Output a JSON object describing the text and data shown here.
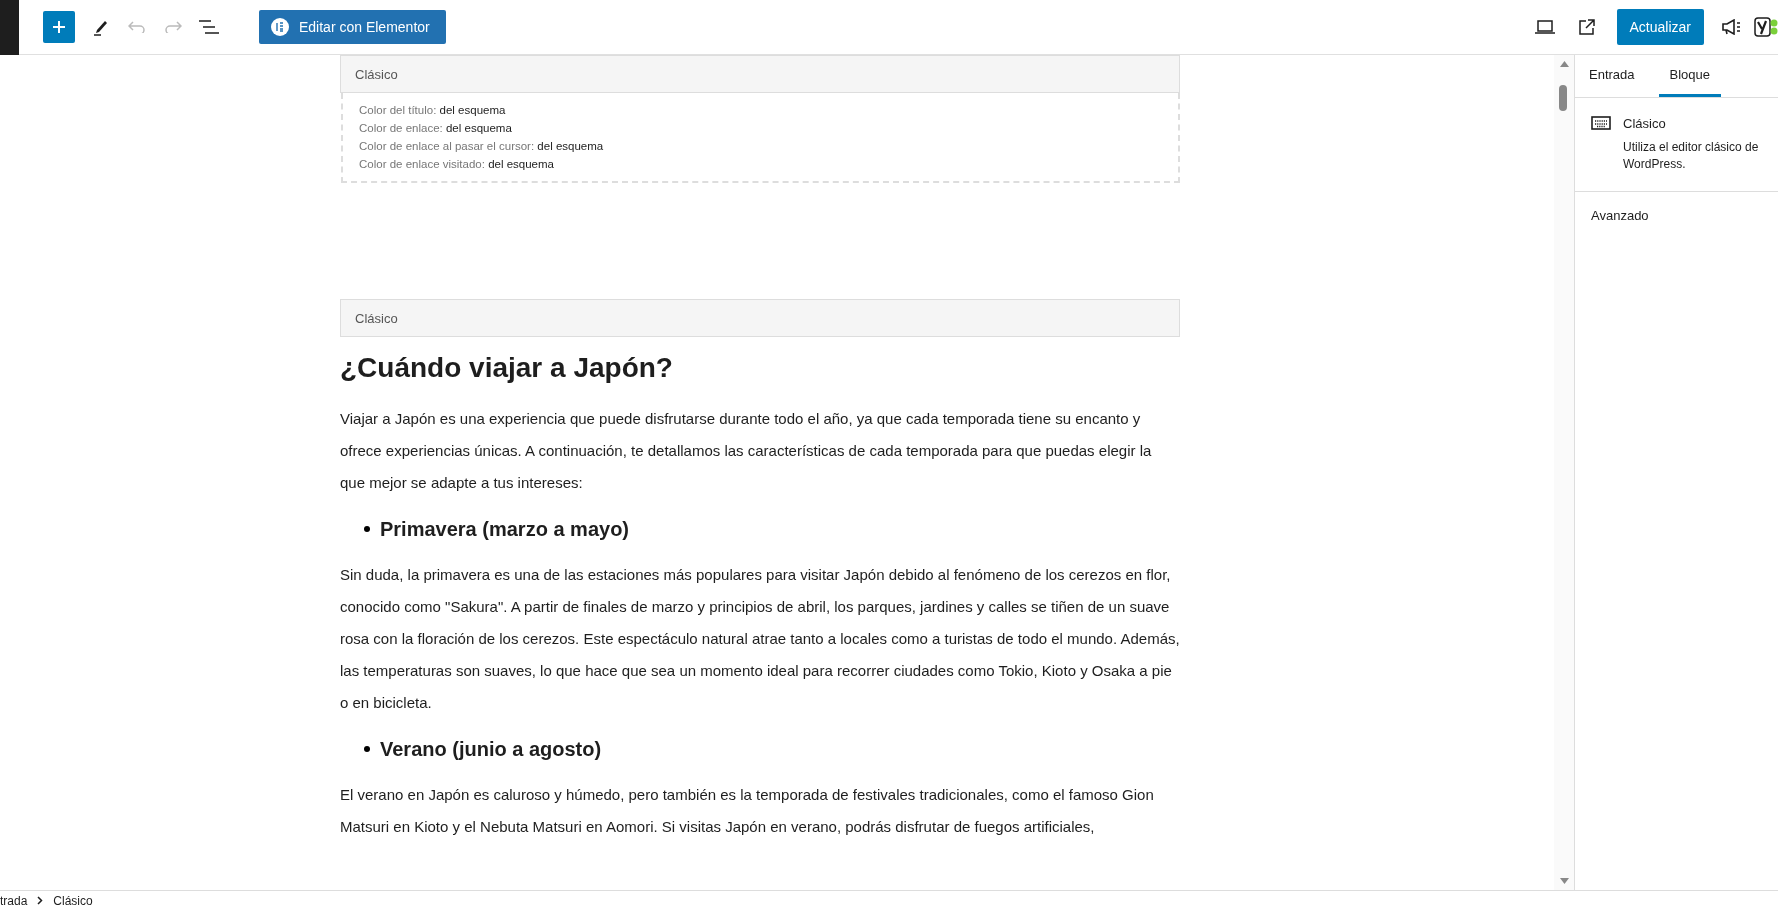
{
  "toolbar": {
    "undo": {
      "disabled": true
    },
    "redo": {
      "disabled": true
    },
    "elementor_button": "Editar con Elementor",
    "update_button": "Actualizar"
  },
  "blocks": [
    {
      "kind": "settings",
      "header": "Clásico",
      "properties": [
        {
          "label": "Color del título:",
          "value": "del esquema"
        },
        {
          "label": "Color de enlace:",
          "value": "del esquema"
        },
        {
          "label": "Color de enlace al pasar el cursor:",
          "value": "del esquema"
        },
        {
          "label": "Color de enlace visitado:",
          "value": "del esquema"
        }
      ]
    },
    {
      "kind": "content",
      "header": "Clásico",
      "content": [
        {
          "kind": "heading",
          "text": "¿Cuándo viajar a Japón?"
        },
        {
          "kind": "paragraph",
          "text": "Viajar a Japón es una experiencia que puede disfrutarse durante todo el año, ya que cada temporada tiene su encanto y ofrece experiencias únicas. A continuación, te detallamos las características de cada temporada para que puedas elegir la que mejor se adapte a tus intereses:"
        },
        {
          "kind": "bullet_heading",
          "text": "Primavera (marzo a mayo)"
        },
        {
          "kind": "paragraph",
          "text": "Sin duda, la primavera es una de las estaciones más populares para visitar Japón debido al fenómeno de los cerezos en flor, conocido como \"Sakura\". A partir de finales de marzo y principios de abril, los parques, jardines y calles se tiñen de un suave rosa con la floración de los cerezos. Este espectáculo natural atrae tanto a locales como a turistas de todo el mundo. Además, las temperaturas son suaves, lo que hace que sea un momento ideal para recorrer ciudades como Tokio, Kioto y Osaka a pie o en bicicleta."
        },
        {
          "kind": "bullet_heading",
          "text": "Verano (junio a agosto)"
        },
        {
          "kind": "paragraph",
          "text": "El verano en Japón es caluroso y húmedo, pero también es la temporada de festivales tradicionales, como el famoso Gion Matsuri en Kioto y el Nebuta Matsuri en Aomori. Si visitas Japón en verano, podrás disfrutar de fuegos artificiales,"
        }
      ]
    }
  ],
  "sidebar": {
    "tabs": [
      {
        "label": "Entrada",
        "selected": false
      },
      {
        "label": "Bloque",
        "selected": true
      }
    ],
    "block": {
      "name": "Clásico",
      "description": "Utiliza el editor clásico de WordPress."
    },
    "panels": [
      "Avanzado"
    ]
  },
  "breadcrumb": [
    "trada",
    "Clásico"
  ]
}
